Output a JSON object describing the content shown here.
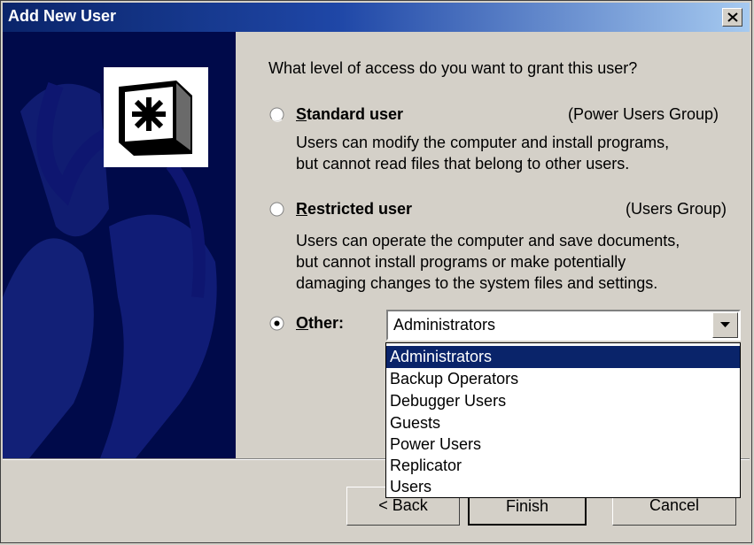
{
  "window": {
    "title": "Add New User",
    "close_label": "X"
  },
  "main": {
    "question": "What level of access do you want to grant this user?",
    "options": [
      {
        "label": "Standard user",
        "group": "(Power Users Group)",
        "lines": [
          "Users can modify the computer and install programs,",
          "but cannot read files that belong to other users."
        ],
        "selected": false
      },
      {
        "label": "Restricted user",
        "group": "(Users Group)",
        "lines": [
          "Users can operate the computer and save documents,",
          "but cannot install programs or make potentially",
          "damaging changes to the system files and settings."
        ],
        "selected": false
      },
      {
        "label": "Other:",
        "selected": true
      }
    ],
    "combo": {
      "value": "Administrators"
    },
    "dropdown": [
      "Administrators",
      "Backup Operators",
      "Debugger Users",
      "Guests",
      "Power Users",
      "Replicator",
      "Users"
    ]
  },
  "buttons": {
    "back": "< Back",
    "finish": "Finish",
    "cancel": "Cancel"
  },
  "colors": {
    "title_bar": "#0a246a",
    "side_panel": "#000a4a",
    "selection": "#0a246a",
    "dialog": "#d4d0c8"
  },
  "icons": {
    "close": "close-icon",
    "logo": "user-accounts-logo-icon",
    "dropdown": "chevron-down-icon"
  }
}
